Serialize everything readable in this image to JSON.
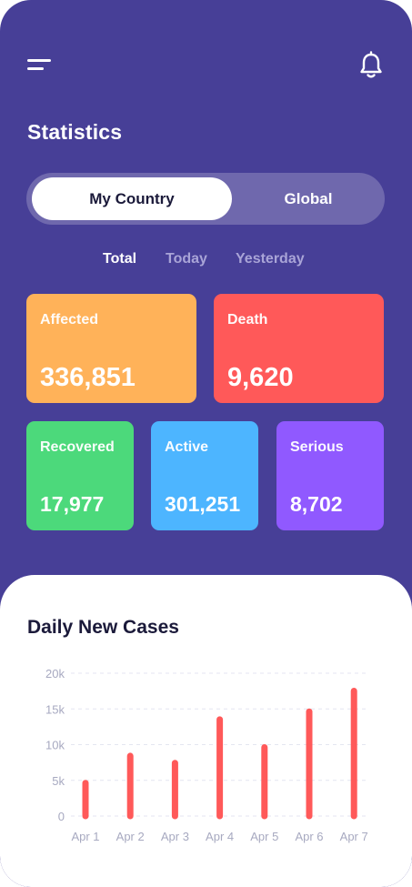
{
  "header": {
    "title": "Statistics"
  },
  "segment": {
    "options": [
      "My Country",
      "Global"
    ],
    "selected": "My Country"
  },
  "period_tabs": {
    "items": [
      "Total",
      "Today",
      "Yesterday"
    ],
    "selected": "Total"
  },
  "stats": [
    {
      "label": "Affected",
      "value": "336,851",
      "color": "#FFB259"
    },
    {
      "label": "Death",
      "value": "9,620",
      "color": "#FF5959"
    },
    {
      "label": "Recovered",
      "value": "17,977",
      "color": "#4CD97B"
    },
    {
      "label": "Active",
      "value": "301,251",
      "color": "#4DB5FF"
    },
    {
      "label": "Serious",
      "value": "8,702",
      "color": "#9059FF"
    }
  ],
  "colors": {
    "background": "#473F97",
    "sheet": "#FFFFFF",
    "bar": "#FF5959",
    "text_dark": "#1B1A3A"
  },
  "icons": {
    "menu": "menu-icon",
    "notifications": "bell-icon"
  },
  "chart_data": {
    "type": "bar",
    "title": "Daily New Cases",
    "categories": [
      "Apr 1",
      "Apr 2",
      "Apr 3",
      "Apr 4",
      "Apr 5",
      "Apr 6",
      "Apr 7"
    ],
    "values": [
      5000,
      8800,
      7800,
      13900,
      10000,
      15000,
      17900
    ],
    "ylim": [
      0,
      20000
    ],
    "yticks": [
      0,
      5000,
      10000,
      15000,
      20000
    ],
    "ytick_labels": [
      "0",
      "5k",
      "10k",
      "15k",
      "20k"
    ],
    "grid": true
  }
}
